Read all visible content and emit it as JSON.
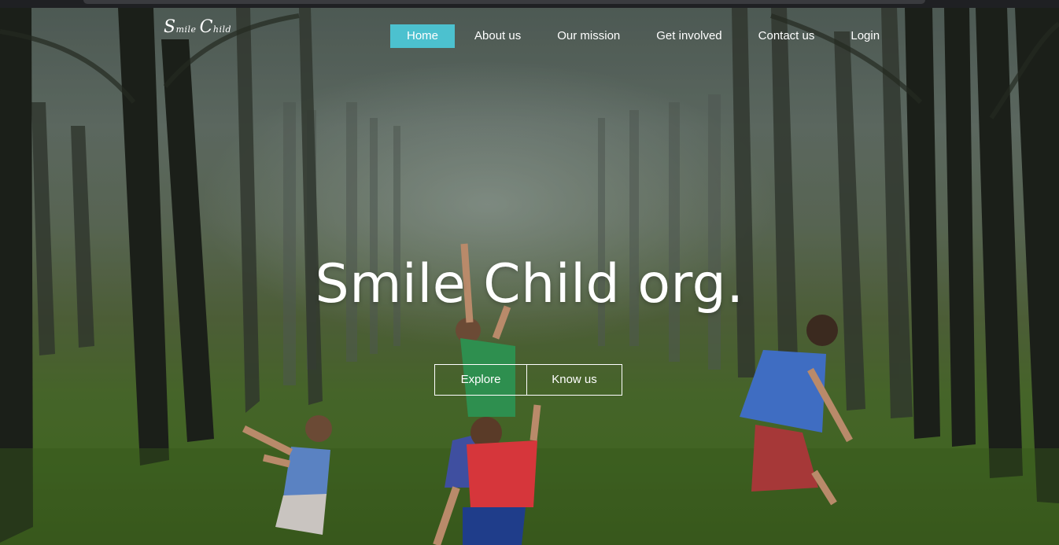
{
  "site": {
    "logo": {
      "initial_1": "S",
      "word_1": "mile",
      "initial_2": "C",
      "word_2": "hild"
    },
    "nav": [
      {
        "label": "Home",
        "active": true
      },
      {
        "label": "About us",
        "active": false
      },
      {
        "label": "Our mission",
        "active": false
      },
      {
        "label": "Get involved",
        "active": false
      },
      {
        "label": "Contact us",
        "active": false
      },
      {
        "label": "Login",
        "active": false
      }
    ],
    "hero": {
      "title": "Smile Child org.",
      "buttons": [
        {
          "label": "Explore"
        },
        {
          "label": "Know us"
        }
      ]
    }
  },
  "colors": {
    "nav_active_bg": "#4cc1cf",
    "text": "#ffffff",
    "browser_chrome": "#1f2023"
  }
}
